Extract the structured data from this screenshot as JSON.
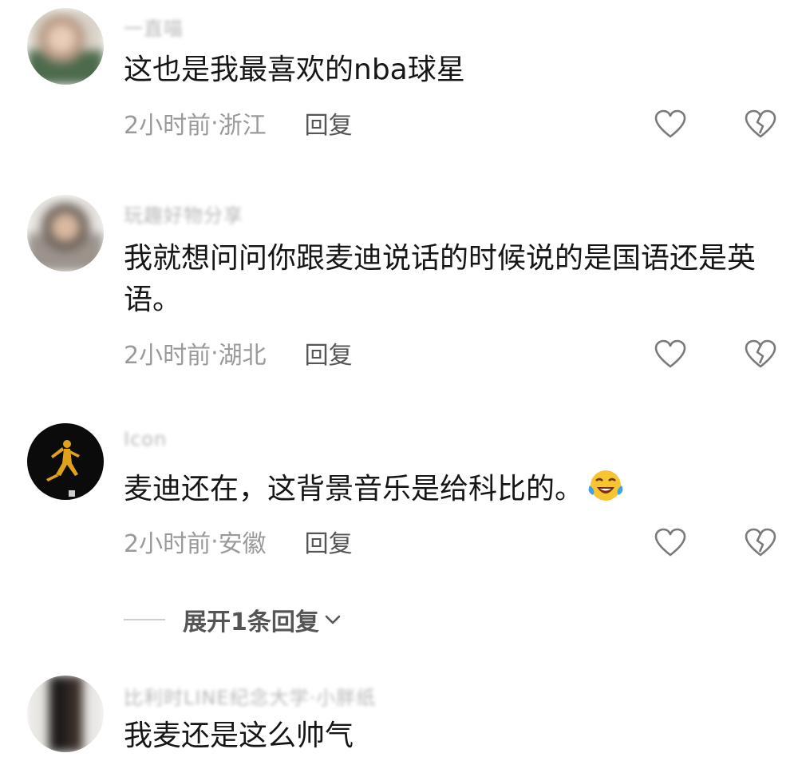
{
  "comments": [
    {
      "username": "一直喵",
      "text": "这也是我最喜欢的nba球星",
      "time": "2小时前",
      "location": "浙江",
      "reply_label": "回复"
    },
    {
      "username": "玩趣好物分享",
      "text": "我就想问问你跟麦迪说话的时候说的是国语还是英语。",
      "time": "2小时前",
      "location": "湖北",
      "reply_label": "回复"
    },
    {
      "username": "Icon",
      "text": "麦迪还在，这背景音乐是给科比的。",
      "time": "2小时前",
      "location": "安徽",
      "reply_label": "回复"
    },
    {
      "username": "比利时LINE纪念大学·小胖纸",
      "text": "我麦还是这么帅气"
    }
  ],
  "expand_replies": {
    "label": "展开1条回复"
  },
  "meta_separator": " · ",
  "icons": {
    "like": "heart-outline-icon",
    "dislike": "broken-heart-outline-icon",
    "emoji": "laughing-tears-emoji-icon",
    "expand": "chevron-down-icon"
  },
  "colors": {
    "text": "#161616",
    "meta": "#9a9a9a",
    "reply": "#555555",
    "icon": "#7a7a7a"
  }
}
